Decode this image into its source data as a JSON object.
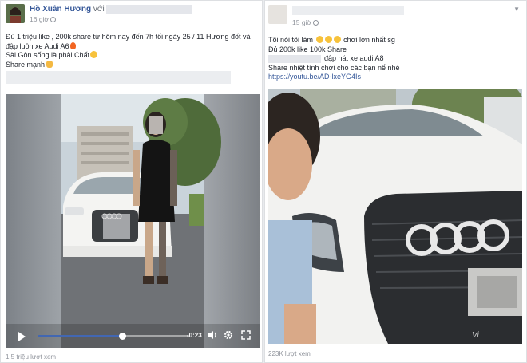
{
  "left_post": {
    "author": "Hồ Xuân Hương",
    "with_text": "với",
    "time": "16 giờ",
    "lines": [
      "Đủ 1 triệu like , 200k share từ hôm nay đến 7h tối ngày 25 / 11 Hương đốt và",
      "đập luôn xe Audi A6",
      "Sài Gòn sống là phải Chất",
      "Share mạnh"
    ],
    "video": {
      "remaining_time": "-0:23",
      "progress_fraction": 0.56
    },
    "views": "1,5 triệu lượt xem",
    "icons": [
      "play-icon",
      "volume-icon",
      "settings-icon",
      "fullscreen-icon"
    ]
  },
  "right_post": {
    "time": "15 giờ",
    "lines": [
      "Tôi nói tôi làm",
      "chơi lớn nhất sg",
      "Đủ 200k like 100k Share",
      "đập nát xe audi A8",
      "Share nhiệt tình chơi cho các bạn nể nhé"
    ],
    "link": "https://youtu.be/AD-lxeYG4Is",
    "watermark": "Vi",
    "views": "223K lượt xem"
  },
  "colors": {
    "link": "#365899",
    "progress": "#4267b2",
    "page_bg": "#e9ebee"
  }
}
